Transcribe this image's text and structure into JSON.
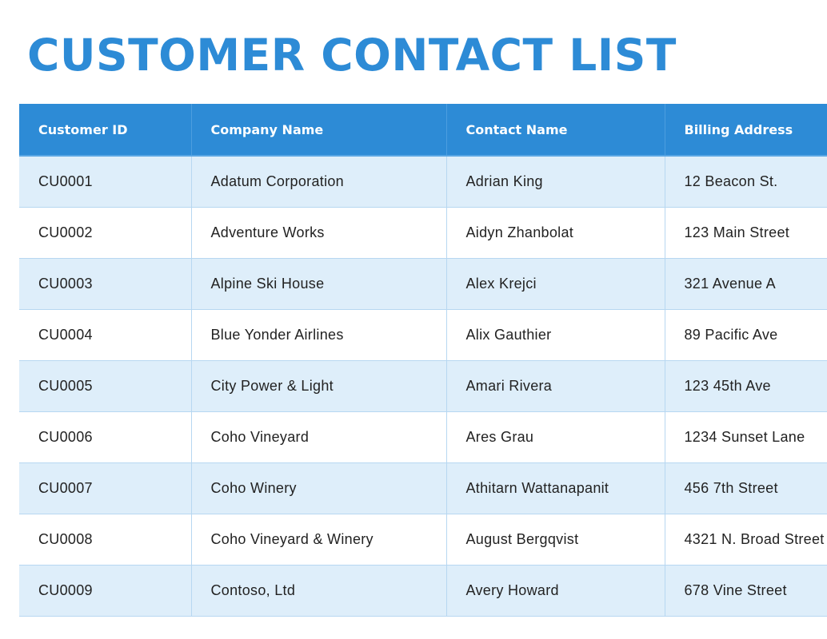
{
  "page": {
    "title": "CUSTOMER CONTACT LIST"
  },
  "table": {
    "headers": [
      "Customer ID",
      "Company Name",
      "Contact Name",
      "Billing Address"
    ],
    "rows": [
      [
        "CU0001",
        "Adatum Corporation",
        "Adrian King",
        "12 Beacon St."
      ],
      [
        "CU0002",
        "Adventure Works",
        "Aidyn Zhanbolat",
        "123 Main Street"
      ],
      [
        "CU0003",
        "Alpine Ski House",
        "Alex Krejci",
        "321 Avenue A"
      ],
      [
        "CU0004",
        "Blue Yonder Airlines",
        "Alix Gauthier",
        "89 Pacific Ave"
      ],
      [
        "CU0005",
        "City Power & Light",
        "Amari Rivera",
        "123 45th Ave"
      ],
      [
        "CU0006",
        "Coho Vineyard",
        "Ares Grau",
        "1234 Sunset Lane"
      ],
      [
        "CU0007",
        "Coho Winery",
        "Athitarn Wattanapanit",
        "456 7th Street"
      ],
      [
        "CU0008",
        "Coho Vineyard & Winery",
        "August Bergqvist",
        "4321 N. Broad Street"
      ],
      [
        "CU0009",
        "Contoso, Ltd",
        "Avery Howard",
        "678 Vine Street"
      ]
    ]
  },
  "colors": {
    "accent": "#2d8bd6",
    "header_text": "#ffffff",
    "row_shaded": "#deeefa",
    "row_plain": "#ffffff",
    "grid_line": "#b7d7f1"
  }
}
